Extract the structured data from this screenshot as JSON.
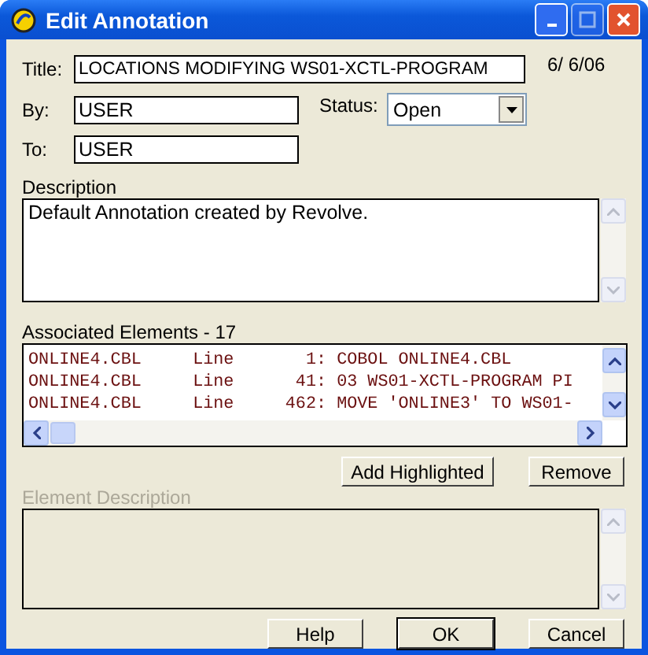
{
  "window": {
    "title": "Edit Annotation"
  },
  "title_field": {
    "label": "Title:",
    "value": "LOCATIONS MODIFYING WS01-XCTL-PROGRAM"
  },
  "date": "6/ 6/06",
  "by_field": {
    "label": "By:",
    "value": "USER"
  },
  "status": {
    "label": "Status:",
    "value": "Open"
  },
  "to_field": {
    "label": "To:",
    "value": "USER"
  },
  "description": {
    "label": "Description",
    "value": "Default Annotation created by Revolve."
  },
  "associated_elements": {
    "label": "Associated Elements - 17",
    "rows": [
      "ONLINE4.CBL     Line       1: COBOL ONLINE4.CBL",
      "ONLINE4.CBL     Line      41: 03 WS01-XCTL-PROGRAM PI",
      "ONLINE4.CBL     Line     462: MOVE 'ONLINE3' TO WS01-"
    ]
  },
  "list_buttons": [
    {
      "label": "Add Highlighted",
      "default": false
    },
    {
      "label": "Remove",
      "default": false
    }
  ],
  "element_description": {
    "label": "Element Description",
    "disabled": true
  },
  "dialog_buttons": [
    {
      "label": "Help",
      "default": false
    },
    {
      "label": "OK",
      "default": true
    },
    {
      "label": "Cancel",
      "default": false
    }
  ]
}
